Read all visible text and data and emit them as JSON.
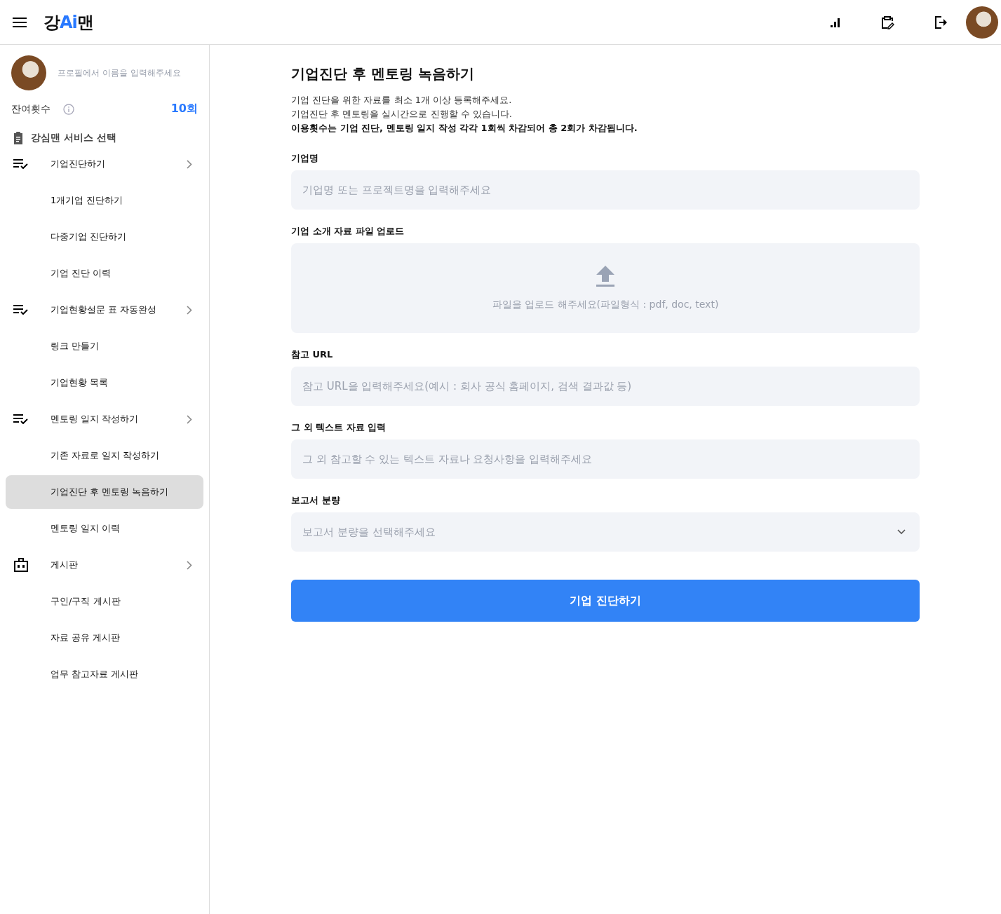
{
  "header": {
    "logo": {
      "before": "강",
      "highlight": "Ai",
      "after": "맨"
    }
  },
  "sidebar": {
    "profile": {
      "name_prompt": "프로필에서 이름을 입력해주세요"
    },
    "remaining": {
      "label": "잔여횟수",
      "value": "10회"
    },
    "section_title": "강심맨 서비스 선택",
    "groups": [
      {
        "label": "기업진단하기",
        "kind": "checklist",
        "children": [
          {
            "label": "1개기업 진단하기",
            "selected": false
          },
          {
            "label": "다중기업 진단하기",
            "selected": false
          },
          {
            "label": "기업 진단 이력",
            "selected": false
          }
        ]
      },
      {
        "label": "기업현황설문 표 자동완성",
        "kind": "checklist",
        "children": [
          {
            "label": "링크 만들기",
            "selected": false
          },
          {
            "label": "기업현황 목록",
            "selected": false
          }
        ]
      },
      {
        "label": "멘토링 일지 작성하기",
        "kind": "checklist",
        "children": [
          {
            "label": "기존 자료로 일지 작성하기",
            "selected": false
          },
          {
            "label": "기업진단 후 멘토링 녹음하기",
            "selected": true
          },
          {
            "label": "멘토링 일지 이력",
            "selected": false
          }
        ]
      },
      {
        "label": "게시판",
        "kind": "board",
        "children": [
          {
            "label": "구인/구직 게시판",
            "selected": false
          },
          {
            "label": "자료 공유 게시판",
            "selected": false
          },
          {
            "label": "업무 참고자료 게시판",
            "selected": false
          }
        ]
      }
    ]
  },
  "main": {
    "title": "기업진단 후 멘토링 녹음하기",
    "descriptions": [
      "기업 진단을 위한 자료를 최소 1개 이상 등록해주세요.",
      "기업진단 후 멘토링을 실시간으로 진행할 수 있습니다."
    ],
    "notice": "이용횟수는 기업 진단, 멘토링 일지 작성 각각 1회씩 차감되어 총 2회가 차감됩니다.",
    "fields": [
      {
        "label": "기업명",
        "kind": "text",
        "placeholder": "기업명 또는 프로젝트명을 입력해주세요"
      },
      {
        "label": "기업 소개 자료 파일 업로드",
        "kind": "upload",
        "placeholder": "파일을 업로드 해주세요(파일형식 : pdf, doc, text)"
      },
      {
        "label": "참고 URL",
        "kind": "text",
        "placeholder": "참고 URL을 입력해주세요(예시 : 회사 공식 홈페이지, 검색 결과값 등)"
      },
      {
        "label": "그 외 텍스트 자료 입력",
        "kind": "text",
        "placeholder": "그 외 참고할 수 있는 텍스트 자료나 요청사항을 입력해주세요"
      },
      {
        "label": "보고서 분량",
        "kind": "select",
        "placeholder": "보고서 분량을 선택해주세요"
      }
    ],
    "submit": "기업 진단하기"
  }
}
